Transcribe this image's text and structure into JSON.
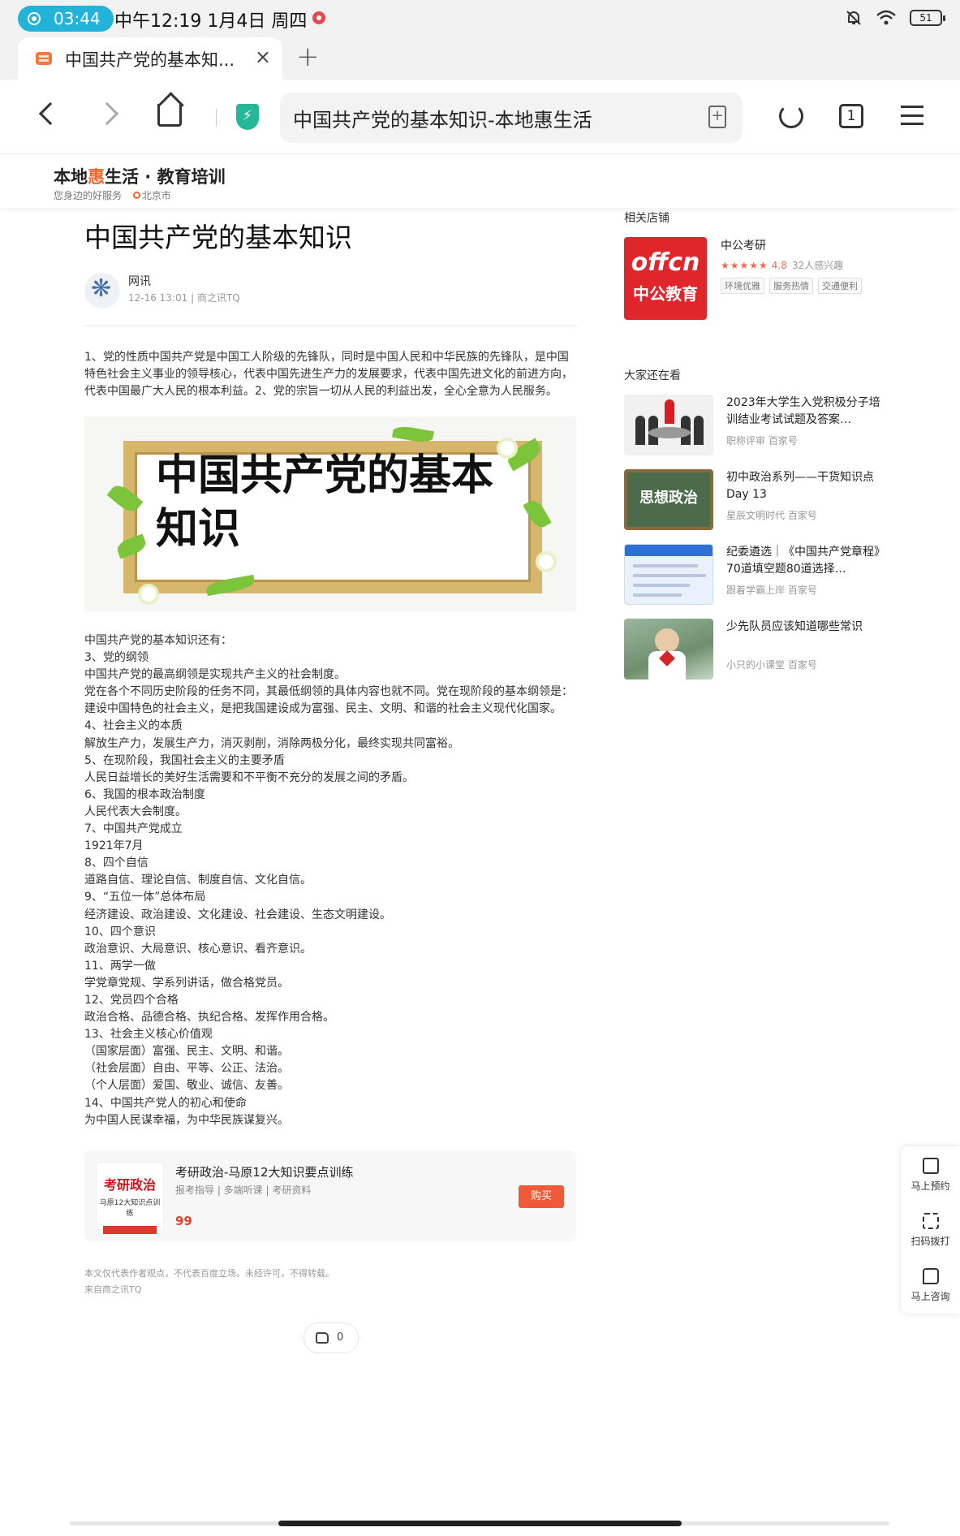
{
  "status_bar": {
    "record_time": "03:44",
    "datetime": "中午12:19 1月4日 周四",
    "battery": "51"
  },
  "browser": {
    "tab_title": "中国共产党的基本知...",
    "tab_close": "×",
    "new_tab": "+",
    "url_text": "中国共产党的基本知识-本地惠生活",
    "tabs_count": "1"
  },
  "site": {
    "logo_prefix": "本地",
    "logo_accent": "惠",
    "logo_suffix": "生活 · 教育培训",
    "slogan": "您身边的好服务",
    "location": "北京市"
  },
  "article": {
    "title": "中国共产党的基本知识",
    "author": "网讯",
    "meta": "12-16 13:01 | 商之讯TQ",
    "intro": "1、党的性质中国共产党是中国工人阶级的先锋队，同时是中国人民和中华民族的先锋队，是中国特色社会主义事业的领导核心，代表中国先进生产力的发展要求，代表中国先进文化的前进方向，代表中国最广大人民的根本利益。2、党的宗旨一切从人民的利益出发，全心全意为人民服务。",
    "banner_text": "中国共产党的基本知识",
    "body_lines": [
      "中国共产党的基本知识还有：",
      "3、党的纲领",
      "中国共产党的最高纲领是实现共产主义的社会制度。",
      "党在各个不同历史阶段的任务不同，其最低纲领的具体内容也就不同。党在现阶段的基本纲领是：建设中国特色的社会主义，是把我国建设成为富强、民主、文明、和谐的社会主义现代化国家。",
      "4、社会主义的本质",
      "解放生产力，发展生产力，消灭剥削，消除两极分化，最终实现共同富裕。",
      "5、在现阶段，我国社会主义的主要矛盾",
      "人民日益增长的美好生活需要和不平衡不充分的发展之间的矛盾。",
      "6、我国的根本政治制度",
      "人民代表大会制度。",
      "7、中国共产党成立",
      "1921年7月",
      "8、四个自信",
      "道路自信、理论自信、制度自信、文化自信。",
      "9、“五位一体”总体布局",
      "经济建设、政治建设、文化建设、社会建设、生态文明建设。",
      "10、四个意识",
      "政治意识、大局意识、核心意识、看齐意识。",
      "11、两学一做",
      "学党章党规、学系列讲话，做合格党员。",
      "12、党员四个合格",
      "政治合格、品德合格、执纪合格、发挥作用合格。",
      "13、社会主义核心价值观",
      "（国家层面）富强、民主、文明、和谐。",
      "（社会层面）自由、平等、公正、法治。",
      "（个人层面）爱国、敬业、诚信、友善。",
      "14、中国共产党人的初心和使命",
      "为中国人民谋幸福，为中华民族谋复兴。"
    ],
    "product": {
      "thumb_title": "考研政治",
      "thumb_sub": "马原12大知识点训练",
      "title": "考研政治-马原12大知识要点训练",
      "tags": "报考指导 | 多端听课 | 考研资料",
      "price": "99",
      "buy_label": "购买"
    },
    "disclaimer": "本文仅代表作者观点，不代表百度立场。未经许可，不得转载。",
    "source": "来自商之讯TQ",
    "like_count": "0"
  },
  "sidebar": {
    "shops_heading": "相关店铺",
    "shop": {
      "logo_line1": "offcn",
      "logo_line2": "中公教育",
      "name": "中公考研",
      "stars": "★★★★★",
      "rating": "4.8",
      "interest": "32人感兴趣",
      "tags": [
        "环境优雅",
        "服务热情",
        "交通便利"
      ]
    },
    "rec_heading": "大家还在看",
    "rec_items": [
      {
        "title": "2023年大学生入党积极分子培训结业考试试题及答案…",
        "source": "职称评审 百家号"
      },
      {
        "title": "初中政治系列——干货知识点 Day 13",
        "source": "星辰文明时代 百家号",
        "thumb_text": "思想政治"
      },
      {
        "title": "纪委遴选｜《中国共产党章程》70道填空题80道选择…",
        "source": "跟着学霸上岸 百家号"
      },
      {
        "title": "少先队员应该知道哪些常识",
        "source": "小只的小课堂 百家号"
      }
    ]
  },
  "float_panel": {
    "items": [
      "马上预约",
      "扫码拨打",
      "马上咨询"
    ]
  },
  "colors": {
    "accent": "#f0662d",
    "record_pill": "#23b2d8",
    "buy_button": "#ef5a3a",
    "shop_logo": "#e0252b"
  }
}
